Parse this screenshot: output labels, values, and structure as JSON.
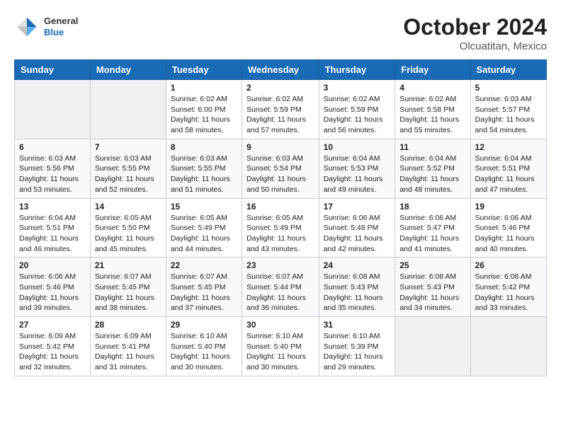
{
  "header": {
    "logo": {
      "general": "General",
      "blue": "Blue"
    },
    "month": "October 2024",
    "location": "Olcuatitan, Mexico"
  },
  "weekdays": [
    "Sunday",
    "Monday",
    "Tuesday",
    "Wednesday",
    "Thursday",
    "Friday",
    "Saturday"
  ],
  "weeks": [
    [
      {
        "day": "",
        "empty": true
      },
      {
        "day": "",
        "empty": true
      },
      {
        "day": "1",
        "sunrise": "6:02 AM",
        "sunset": "6:00 PM",
        "daylight": "11 hours and 58 minutes."
      },
      {
        "day": "2",
        "sunrise": "6:02 AM",
        "sunset": "5:59 PM",
        "daylight": "11 hours and 57 minutes."
      },
      {
        "day": "3",
        "sunrise": "6:02 AM",
        "sunset": "5:59 PM",
        "daylight": "11 hours and 56 minutes."
      },
      {
        "day": "4",
        "sunrise": "6:02 AM",
        "sunset": "5:58 PM",
        "daylight": "11 hours and 55 minutes."
      },
      {
        "day": "5",
        "sunrise": "6:03 AM",
        "sunset": "5:57 PM",
        "daylight": "11 hours and 54 minutes."
      }
    ],
    [
      {
        "day": "6",
        "sunrise": "6:03 AM",
        "sunset": "5:56 PM",
        "daylight": "11 hours and 53 minutes."
      },
      {
        "day": "7",
        "sunrise": "6:03 AM",
        "sunset": "5:55 PM",
        "daylight": "11 hours and 52 minutes."
      },
      {
        "day": "8",
        "sunrise": "6:03 AM",
        "sunset": "5:55 PM",
        "daylight": "11 hours and 51 minutes."
      },
      {
        "day": "9",
        "sunrise": "6:03 AM",
        "sunset": "5:54 PM",
        "daylight": "11 hours and 50 minutes."
      },
      {
        "day": "10",
        "sunrise": "6:04 AM",
        "sunset": "5:53 PM",
        "daylight": "11 hours and 49 minutes."
      },
      {
        "day": "11",
        "sunrise": "6:04 AM",
        "sunset": "5:52 PM",
        "daylight": "11 hours and 48 minutes."
      },
      {
        "day": "12",
        "sunrise": "6:04 AM",
        "sunset": "5:51 PM",
        "daylight": "11 hours and 47 minutes."
      }
    ],
    [
      {
        "day": "13",
        "sunrise": "6:04 AM",
        "sunset": "5:51 PM",
        "daylight": "11 hours and 46 minutes."
      },
      {
        "day": "14",
        "sunrise": "6:05 AM",
        "sunset": "5:50 PM",
        "daylight": "11 hours and 45 minutes."
      },
      {
        "day": "15",
        "sunrise": "6:05 AM",
        "sunset": "5:49 PM",
        "daylight": "11 hours and 44 minutes."
      },
      {
        "day": "16",
        "sunrise": "6:05 AM",
        "sunset": "5:49 PM",
        "daylight": "11 hours and 43 minutes."
      },
      {
        "day": "17",
        "sunrise": "6:06 AM",
        "sunset": "5:48 PM",
        "daylight": "11 hours and 42 minutes."
      },
      {
        "day": "18",
        "sunrise": "6:06 AM",
        "sunset": "5:47 PM",
        "daylight": "11 hours and 41 minutes."
      },
      {
        "day": "19",
        "sunrise": "6:06 AM",
        "sunset": "5:46 PM",
        "daylight": "11 hours and 40 minutes."
      }
    ],
    [
      {
        "day": "20",
        "sunrise": "6:06 AM",
        "sunset": "5:46 PM",
        "daylight": "11 hours and 39 minutes."
      },
      {
        "day": "21",
        "sunrise": "6:07 AM",
        "sunset": "5:45 PM",
        "daylight": "11 hours and 38 minutes."
      },
      {
        "day": "22",
        "sunrise": "6:07 AM",
        "sunset": "5:45 PM",
        "daylight": "11 hours and 37 minutes."
      },
      {
        "day": "23",
        "sunrise": "6:07 AM",
        "sunset": "5:44 PM",
        "daylight": "11 hours and 36 minutes."
      },
      {
        "day": "24",
        "sunrise": "6:08 AM",
        "sunset": "5:43 PM",
        "daylight": "11 hours and 35 minutes."
      },
      {
        "day": "25",
        "sunrise": "6:08 AM",
        "sunset": "5:43 PM",
        "daylight": "11 hours and 34 minutes."
      },
      {
        "day": "26",
        "sunrise": "6:08 AM",
        "sunset": "5:42 PM",
        "daylight": "11 hours and 33 minutes."
      }
    ],
    [
      {
        "day": "27",
        "sunrise": "6:09 AM",
        "sunset": "5:42 PM",
        "daylight": "11 hours and 32 minutes."
      },
      {
        "day": "28",
        "sunrise": "6:09 AM",
        "sunset": "5:41 PM",
        "daylight": "11 hours and 31 minutes."
      },
      {
        "day": "29",
        "sunrise": "6:10 AM",
        "sunset": "5:40 PM",
        "daylight": "11 hours and 30 minutes."
      },
      {
        "day": "30",
        "sunrise": "6:10 AM",
        "sunset": "5:40 PM",
        "daylight": "11 hours and 30 minutes."
      },
      {
        "day": "31",
        "sunrise": "6:10 AM",
        "sunset": "5:39 PM",
        "daylight": "11 hours and 29 minutes."
      },
      {
        "day": "",
        "empty": true
      },
      {
        "day": "",
        "empty": true
      }
    ]
  ],
  "labels": {
    "sunrise_prefix": "Sunrise: ",
    "sunset_prefix": "Sunset: ",
    "daylight_prefix": "Daylight: "
  }
}
